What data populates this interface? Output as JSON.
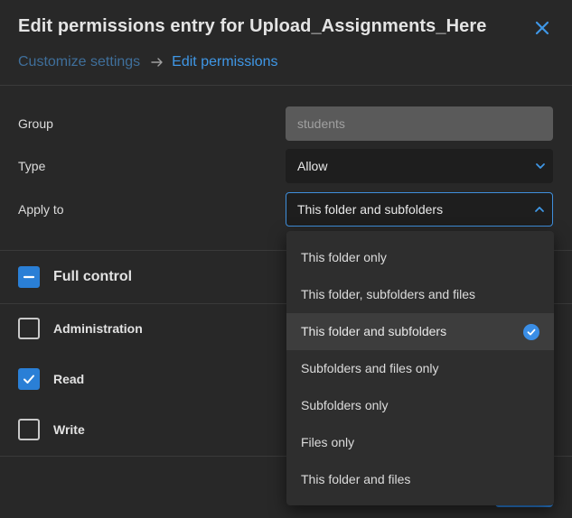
{
  "dialog": {
    "title": "Edit permissions entry for Upload_Assignments_Here",
    "breadcrumb": {
      "previous": "Customize settings",
      "current": "Edit permissions"
    }
  },
  "form": {
    "group": {
      "label": "Group",
      "value": "students"
    },
    "type": {
      "label": "Type",
      "value": "Allow"
    },
    "apply_to": {
      "label": "Apply to",
      "value": "This folder and subfolders"
    }
  },
  "permissions": [
    {
      "label": "Full control",
      "state": "indeterminate"
    },
    {
      "label": "Administration",
      "state": "unchecked"
    },
    {
      "label": "Read",
      "state": "checked"
    },
    {
      "label": "Write",
      "state": "unchecked"
    }
  ],
  "apply_to_options": [
    {
      "label": "This folder only",
      "selected": false
    },
    {
      "label": "This folder, subfolders and files",
      "selected": false
    },
    {
      "label": "This folder and subfolders",
      "selected": true
    },
    {
      "label": "Subfolders and files only",
      "selected": false
    },
    {
      "label": "Subfolders only",
      "selected": false
    },
    {
      "label": "Files only",
      "selected": false
    },
    {
      "label": "This folder and files",
      "selected": false
    }
  ],
  "colors": {
    "accent": "#2a7fd6",
    "background": "#282828",
    "dropdown": "#2e2e2e"
  },
  "icons": {
    "close": "close-icon",
    "breadcrumb_separator": "arrow-right-icon",
    "select_chevron_down": "chevron-down-icon",
    "select_chevron_up": "chevron-up-icon",
    "selected_check": "check-circle-icon"
  }
}
